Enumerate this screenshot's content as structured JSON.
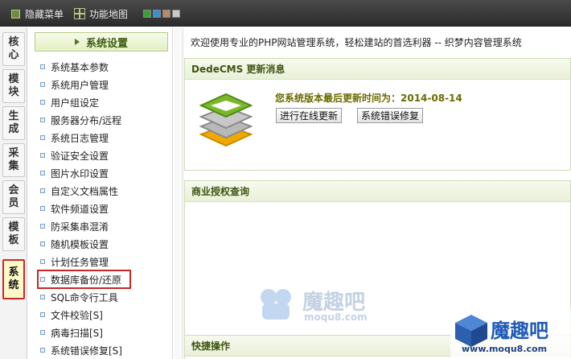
{
  "topbar": {
    "hide_menu": "隐藏菜单",
    "function_map": "功能地图",
    "swatch_colors": [
      "#3aa03a",
      "#3a8fd0",
      "#b88a6a",
      "#c8c8c8"
    ]
  },
  "vtabs": [
    {
      "c1": "核",
      "c2": "心"
    },
    {
      "c1": "模",
      "c2": "块"
    },
    {
      "c1": "生",
      "c2": "成"
    },
    {
      "c1": "采",
      "c2": "集"
    },
    {
      "c1": "会",
      "c2": "员"
    },
    {
      "c1": "模",
      "c2": "板"
    },
    {
      "c1": "系",
      "c2": "统"
    }
  ],
  "menu": {
    "header": "系统设置",
    "items": [
      "系统基本参数",
      "系统用户管理",
      "用户组设定",
      "服务器分布/远程",
      "系统日志管理",
      "验证安全设置",
      "图片水印设置",
      "自定义文档属性",
      "软件频道设置",
      "防采集串混淆",
      "随机模板设置",
      "计划任务管理",
      "数据库备份/还原",
      "SQL命令行工具",
      "文件校验[S]",
      "病毒扫描[S]",
      "系统错误修复[S]"
    ]
  },
  "main": {
    "welcome": "欢迎使用专业的PHP网站管理系统，轻松建站的首选利器 -- 织梦内容管理系统",
    "update_panel": {
      "title": "DedeCMS 更新消息",
      "last_update": "您系统版本最后更新时间为：2014-08-14",
      "btn_online_update": "进行在线更新",
      "btn_repair": "系统错误修复"
    },
    "license_panel": {
      "title": "商业授权查询"
    },
    "quick_panel": {
      "title": "快捷操作"
    }
  },
  "watermark": {
    "center_cn": "魔趣吧",
    "center_url": "moqu8.com",
    "corner_cn": "魔趣吧",
    "corner_url": "www.moqu8.com"
  }
}
